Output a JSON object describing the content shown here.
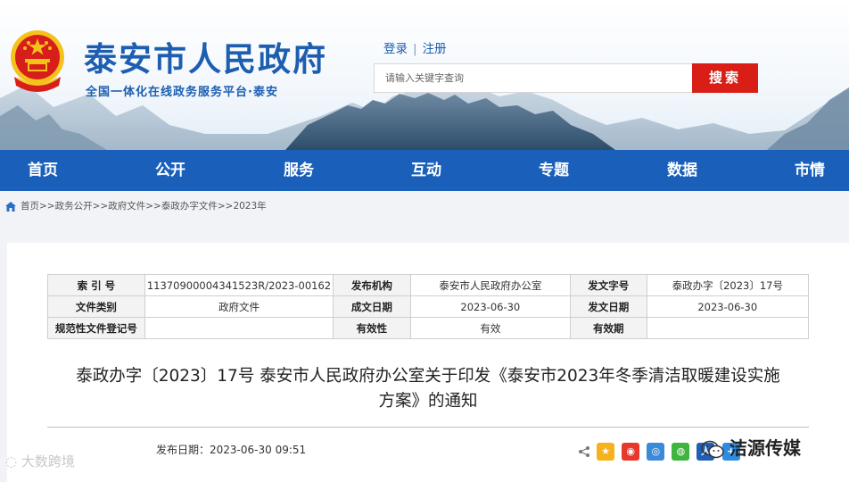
{
  "header": {
    "title": "泰安市人民政府",
    "subtitle": "全国一体化在线政务服务平台·泰安",
    "login": "登录",
    "separator": "|",
    "register": "注册",
    "search_placeholder": "请输入关键字查询",
    "search_button": "搜索"
  },
  "nav": {
    "items": [
      "首页",
      "公开",
      "服务",
      "互动",
      "专题",
      "数据",
      "市情"
    ]
  },
  "breadcrumb": [
    "首页",
    ">>",
    "政务公开",
    ">>",
    "政府文件",
    ">>",
    "泰政办字文件",
    ">>",
    "2023年"
  ],
  "meta": {
    "index_label": "索 引 号",
    "index_value": "11370900004341523R/2023-00162",
    "issuer_label": "发布机构",
    "issuer_value": "泰安市人民政府办公室",
    "docno_label": "发文字号",
    "docno_value": "泰政办字〔2023〕17号",
    "category_label": "文件类别",
    "category_value": "政府文件",
    "written_label": "成文日期",
    "written_value": "2023-06-30",
    "pubdate_label": "发文日期",
    "pubdate_value": "2023-06-30",
    "regno_label": "规范性文件登记号",
    "regno_value": "",
    "validity_label": "有效性",
    "validity_value": "有效",
    "period_label": "有效期",
    "period_value": ""
  },
  "document": {
    "title_line1": "泰政办字〔2023〕17号 泰安市人民政府办公室关于印发《泰安市2023年冬季清洁取暖建设实施",
    "title_line2": "方案》的通知",
    "publish_label": "发布日期：",
    "publish_value": "2023-06-30 09:51"
  },
  "share_icons": [
    "share-icon",
    "qzone-icon",
    "weibo-icon",
    "tencent-weibo-icon",
    "wechat-icon",
    "renren-icon",
    "plus-icon"
  ],
  "watermarks": {
    "left": "大数跨境",
    "right": "洁源传媒"
  },
  "colors": {
    "brand_blue": "#1a5fba",
    "search_red": "#d91e17"
  }
}
